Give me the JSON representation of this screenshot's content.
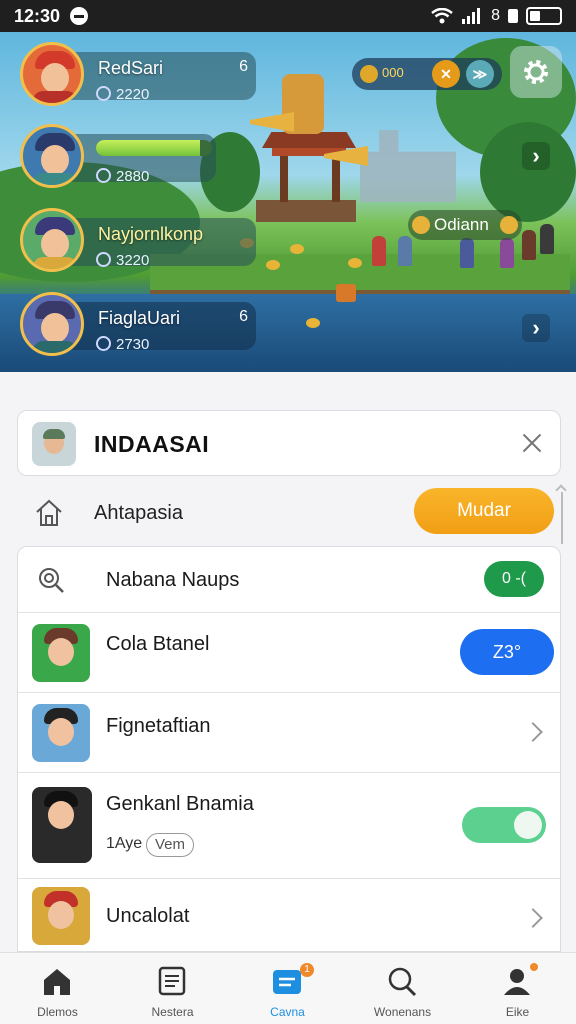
{
  "status_bar": {
    "time": "12:30",
    "indicators": "8"
  },
  "colors": {
    "accent": "#1e8fe0",
    "orange_button": "#f5a21a",
    "green_badge": "#1f9a4a",
    "blue_pill": "#1d6ef0",
    "toggle_on": "#5bd08f"
  },
  "game": {
    "players": [
      {
        "name": "RedSari",
        "score": "2220",
        "mark": "6"
      },
      {
        "name": "",
        "score": "2880",
        "progress": 0.9
      },
      {
        "name": "Nayjornlkonp",
        "score": "3220"
      },
      {
        "name": "FiaglaUari",
        "score": "2730",
        "mark": "6"
      }
    ],
    "hud_value": "000",
    "label_pill": "Odiann",
    "icons": [
      "settings-gear-icon",
      "next-arrow-icon"
    ]
  },
  "search_card": {
    "title": "INDAASAI"
  },
  "home_row": {
    "label": "Ahtapasia",
    "button": "Mudar"
  },
  "list": [
    {
      "label": "Nabana Naups",
      "badge": "0 -(",
      "type": "search"
    },
    {
      "label": "Cola Btanel",
      "pill": "Z3°",
      "type": "game"
    },
    {
      "label": "Fignetaftian",
      "type": "game"
    },
    {
      "label": "Genkanl Bnamia",
      "sub": "1Aye",
      "tag": "Vem",
      "toggle_on": true,
      "type": "game"
    },
    {
      "label": "Uncalolat",
      "type": "game"
    }
  ],
  "tabs": [
    {
      "label": "Dlemos",
      "icon": "home-icon"
    },
    {
      "label": "Nestera",
      "icon": "news-icon"
    },
    {
      "label": "Cavna",
      "icon": "games-icon",
      "active": true,
      "badge": "1"
    },
    {
      "label": "Wonenans",
      "icon": "search-icon"
    },
    {
      "label": "Eike",
      "icon": "profile-icon",
      "badge": ""
    }
  ]
}
